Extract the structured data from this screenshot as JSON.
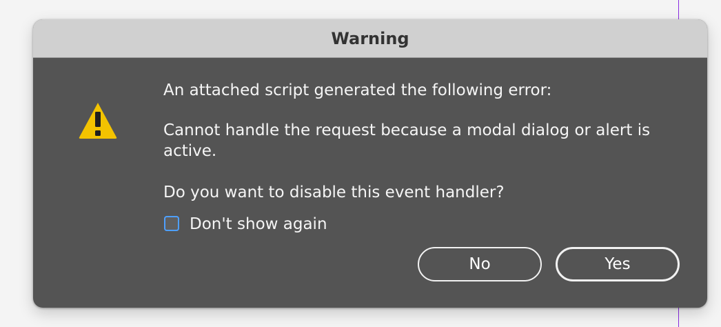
{
  "window": {
    "title": "Warning"
  },
  "icons": {
    "warning": {
      "name": "warning-icon",
      "color": "#f3c300"
    }
  },
  "message": {
    "line1": "An attached script generated the following error:",
    "line2": "Cannot handle the request because a modal dialog or alert is active.",
    "line3": "Do you want to disable this event handler?"
  },
  "checkbox": {
    "label": "Don't show again",
    "checked": false,
    "accent_color": "#4ea0ff"
  },
  "buttons": {
    "no": "No",
    "yes": "Yes"
  },
  "colors": {
    "dialog_background": "#545454",
    "titlebar_background": "#d0d0d0",
    "text": "#f5f5f5"
  }
}
